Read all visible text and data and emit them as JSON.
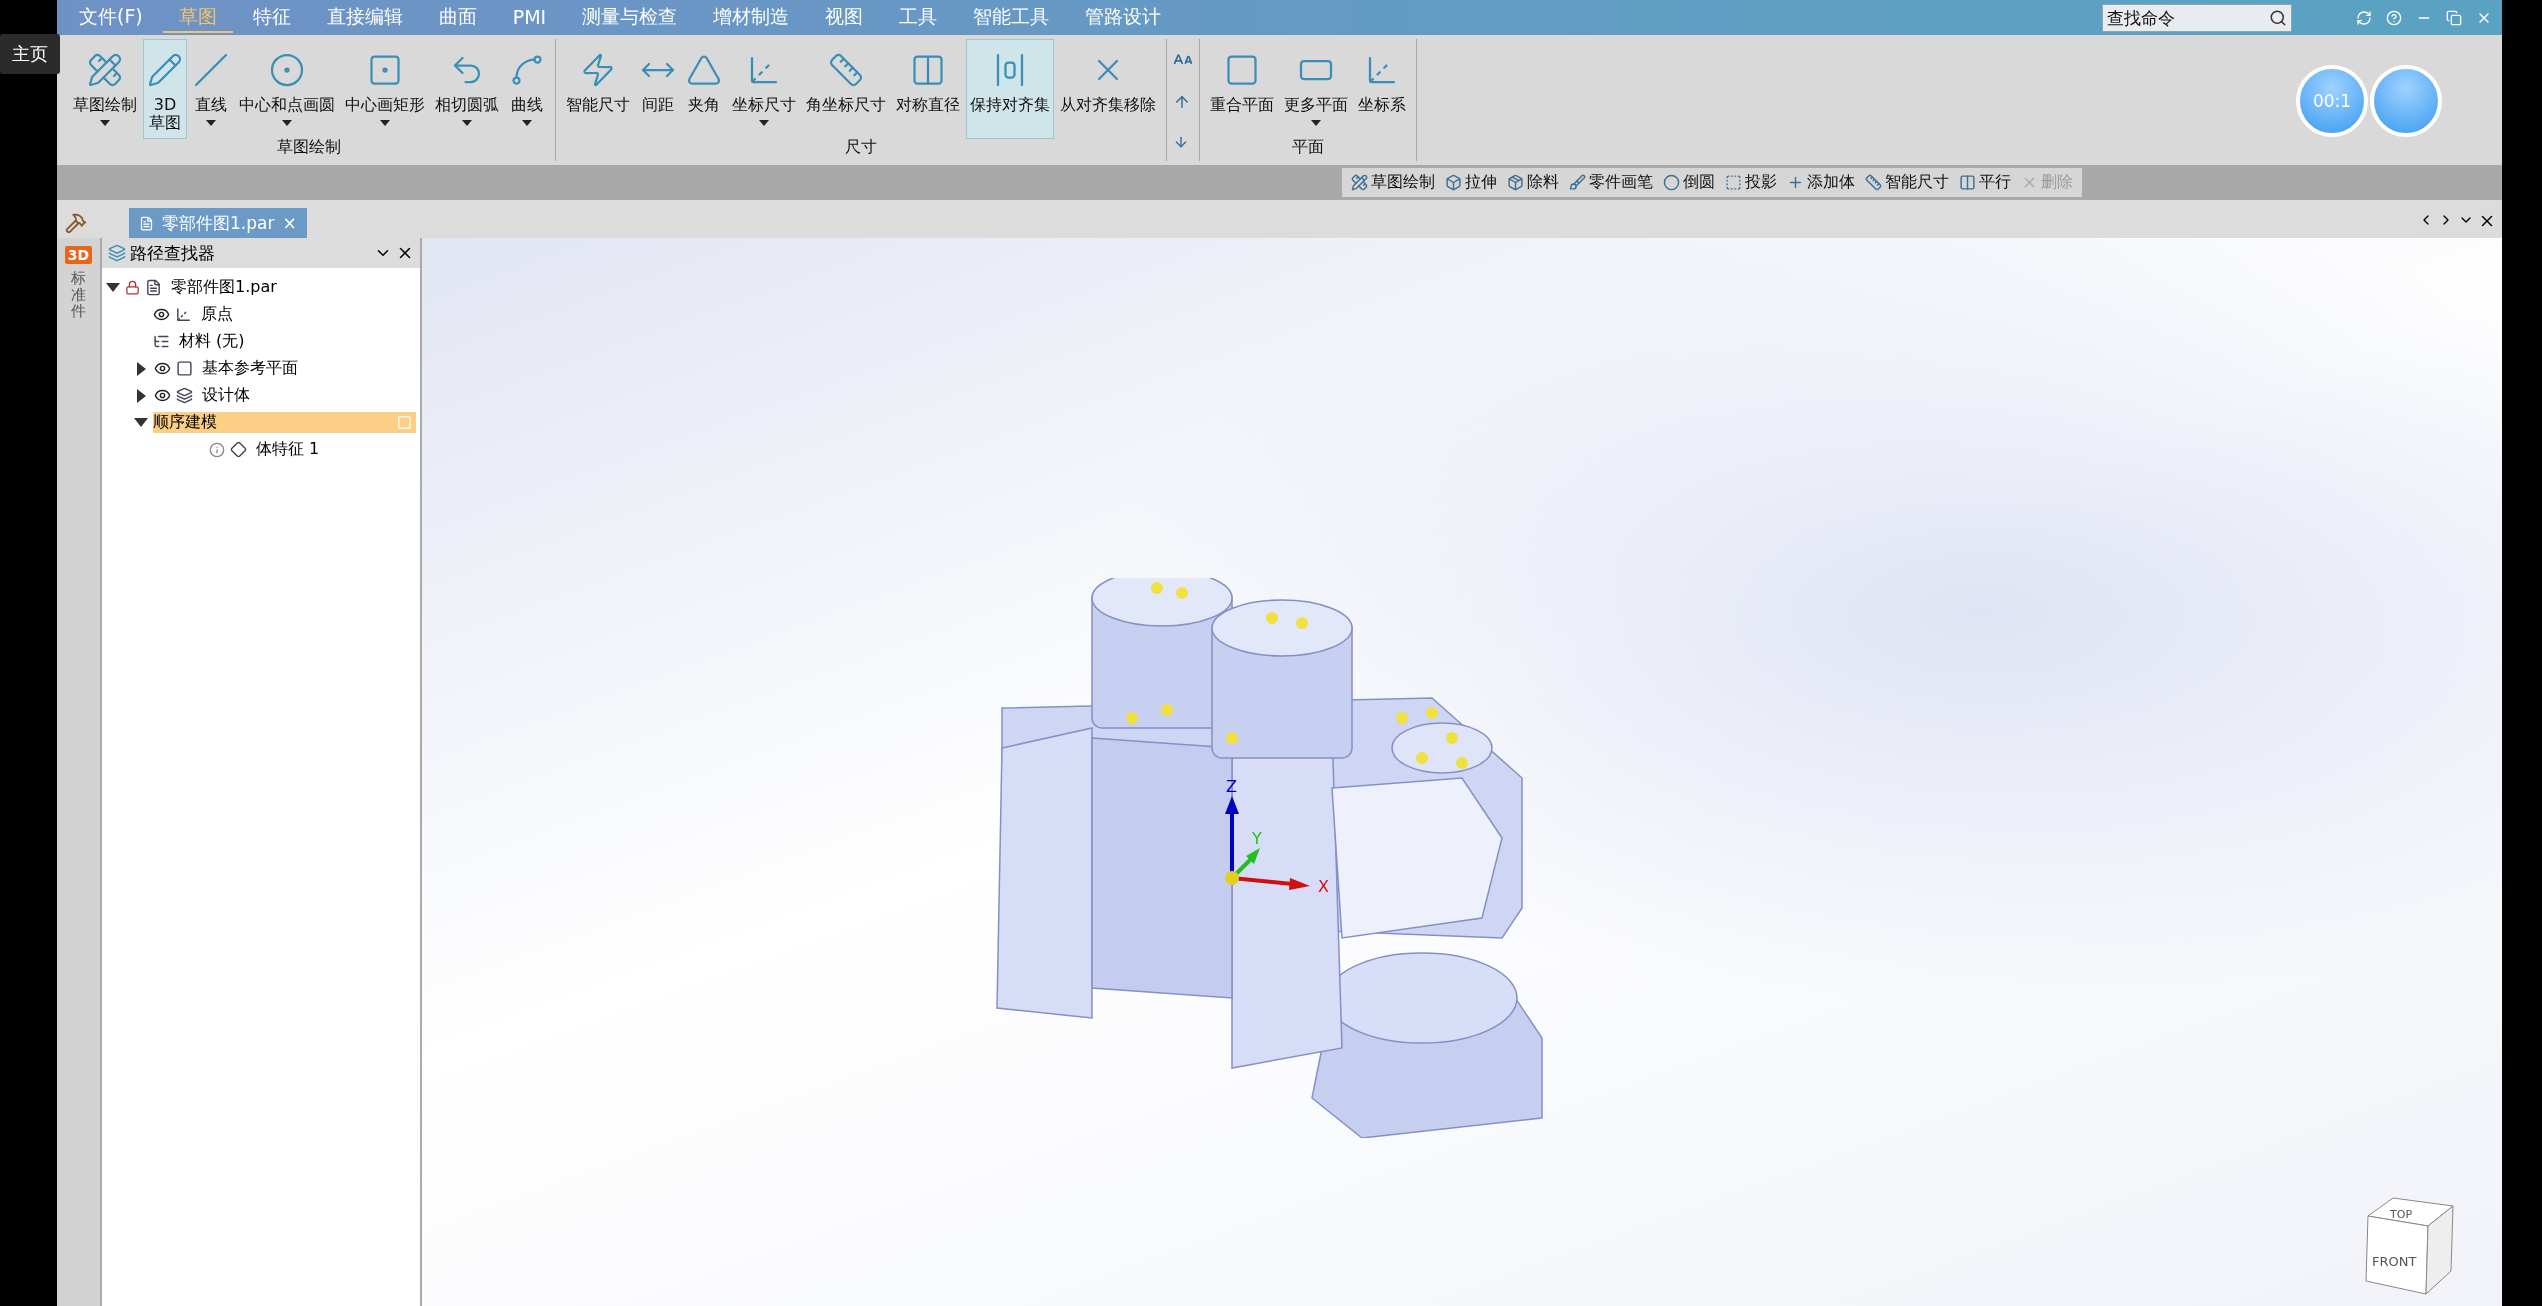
{
  "home_tooltip": "主页",
  "menu": {
    "items": [
      {
        "label": "文件(F)",
        "selected": false
      },
      {
        "label": "草图",
        "selected": true
      },
      {
        "label": "特征",
        "selected": false
      },
      {
        "label": "直接编辑",
        "selected": false
      },
      {
        "label": "曲面",
        "selected": false
      },
      {
        "label": "PMI",
        "selected": false
      },
      {
        "label": "测量与检查",
        "selected": false
      },
      {
        "label": "增材制造",
        "selected": false
      },
      {
        "label": "视图",
        "selected": false
      },
      {
        "label": "工具",
        "selected": false
      },
      {
        "label": "智能工具",
        "selected": false
      },
      {
        "label": "管路设计",
        "selected": false
      }
    ],
    "search": {
      "placeholder": "查找命令"
    }
  },
  "ribbon": {
    "groups": [
      {
        "title": "草图绘制",
        "buttons": [
          {
            "lines": [
              "草图绘制"
            ],
            "dropdown": true,
            "selected": false
          },
          {
            "lines": [
              "3D",
              "草图"
            ],
            "dropdown": false,
            "selected": true
          },
          {
            "lines": [
              "直线"
            ],
            "dropdown": true,
            "selected": false
          },
          {
            "lines": [
              "中心和点画圆"
            ],
            "dropdown": true,
            "selected": false
          },
          {
            "lines": [
              "中心画矩形"
            ],
            "dropdown": true,
            "selected": false
          },
          {
            "lines": [
              "相切圆弧"
            ],
            "dropdown": true,
            "selected": false
          },
          {
            "lines": [
              "曲线"
            ],
            "dropdown": true,
            "selected": false
          }
        ]
      },
      {
        "title": "尺寸",
        "buttons": [
          {
            "lines": [
              "智能尺寸"
            ],
            "dropdown": false,
            "selected": false
          },
          {
            "lines": [
              "间距"
            ],
            "dropdown": false,
            "selected": false
          },
          {
            "lines": [
              "夹角"
            ],
            "dropdown": false,
            "selected": false
          },
          {
            "lines": [
              "坐标尺寸"
            ],
            "dropdown": true,
            "selected": false
          },
          {
            "lines": [
              "角坐标尺寸"
            ],
            "dropdown": false,
            "selected": false
          },
          {
            "lines": [
              "对称直径"
            ],
            "dropdown": false,
            "selected": false
          },
          {
            "lines": [
              "保持对齐集"
            ],
            "dropdown": false,
            "selected": true
          },
          {
            "lines": [
              "从对齐集移除"
            ],
            "dropdown": false,
            "selected": false
          }
        ]
      },
      {
        "title": "平面",
        "buttons": [
          {
            "lines": [
              "重合平面"
            ],
            "dropdown": false,
            "selected": false
          },
          {
            "lines": [
              "更多平面"
            ],
            "dropdown": true,
            "selected": false
          },
          {
            "lines": [
              "坐标系"
            ],
            "dropdown": false,
            "selected": false
          }
        ]
      }
    ],
    "timer": "00:1"
  },
  "quick_toolbar": [
    {
      "label": "草图绘制",
      "disabled": false
    },
    {
      "label": "拉伸",
      "disabled": false
    },
    {
      "label": "除料",
      "disabled": false
    },
    {
      "label": "零件画笔",
      "disabled": false
    },
    {
      "label": "倒圆",
      "disabled": false
    },
    {
      "label": "投影",
      "disabled": false
    },
    {
      "label": "添加体",
      "disabled": false
    },
    {
      "label": "智能尺寸",
      "disabled": false
    },
    {
      "label": "平行",
      "disabled": false
    },
    {
      "label": "删除",
      "disabled": true
    }
  ],
  "document_tab": {
    "label": "零部件图1.par",
    "close": "×"
  },
  "side_bar": {
    "badge": "3D",
    "label": "标准件"
  },
  "path_finder": {
    "title": "路径查找器",
    "tree": [
      {
        "label": "零部件图1.par",
        "kind": "part",
        "expanded": true,
        "visible": false,
        "selected": false,
        "children": [
          {
            "label": "原点",
            "kind": "origin",
            "visible": true,
            "selected": false
          },
          {
            "label": "材料 (无)",
            "kind": "material",
            "visible": false,
            "selected": false
          },
          {
            "label": "基本参考平面",
            "kind": "planes",
            "expanded": false,
            "visible": true,
            "selected": false
          },
          {
            "label": "设计体",
            "kind": "bodies",
            "expanded": false,
            "visible": true,
            "selected": false
          },
          {
            "label": "顺序建模",
            "kind": "sequence",
            "expanded": true,
            "visible": false,
            "selected": true,
            "children": [
              {
                "label": "体特征 1",
                "kind": "feature",
                "visible": false,
                "selected": false
              }
            ]
          }
        ]
      }
    ]
  },
  "viewport": {
    "axes": [
      "Z",
      "Y",
      "X"
    ],
    "view_cube": {
      "top": "TOP",
      "front": "FRONT"
    }
  }
}
